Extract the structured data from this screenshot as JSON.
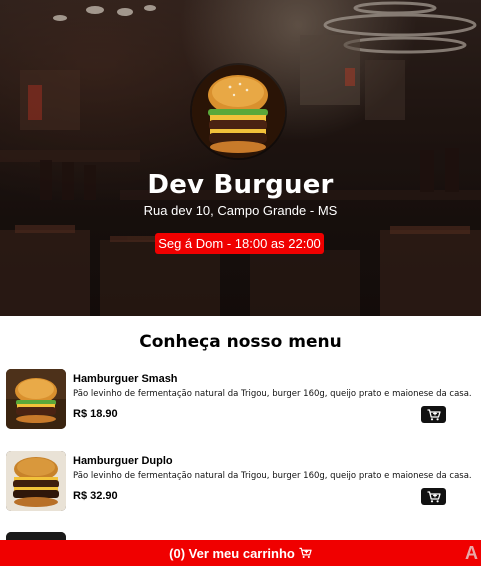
{
  "header": {
    "title": "Dev Burguer",
    "address": "Rua dev 10, Campo Grande - MS",
    "hours": "Seg á Dom - 18:00 as 22:00"
  },
  "menu": {
    "title": "Conheça nosso menu",
    "items": [
      {
        "name": "Hamburguer Smash",
        "description": "Pão levinho de fermentação natural da Trigou, burger 160g, queijo prato e maionese da casa.",
        "price": "R$ 18.90",
        "icon": "add-to-cart-icon"
      },
      {
        "name": "Hamburguer Duplo",
        "description": "Pão levinho de fermentação natural da Trigou, burger 160g, queijo prato e maionese da casa.",
        "price": "R$ 32.90",
        "icon": "add-to-cart-icon"
      }
    ]
  },
  "footer": {
    "cart_label": "(0) Ver meu carrinho",
    "cart_icon": "cart-icon"
  },
  "colors": {
    "accent": "#f00000",
    "button_dark": "#111111",
    "hero_dark": "#1e1411"
  }
}
